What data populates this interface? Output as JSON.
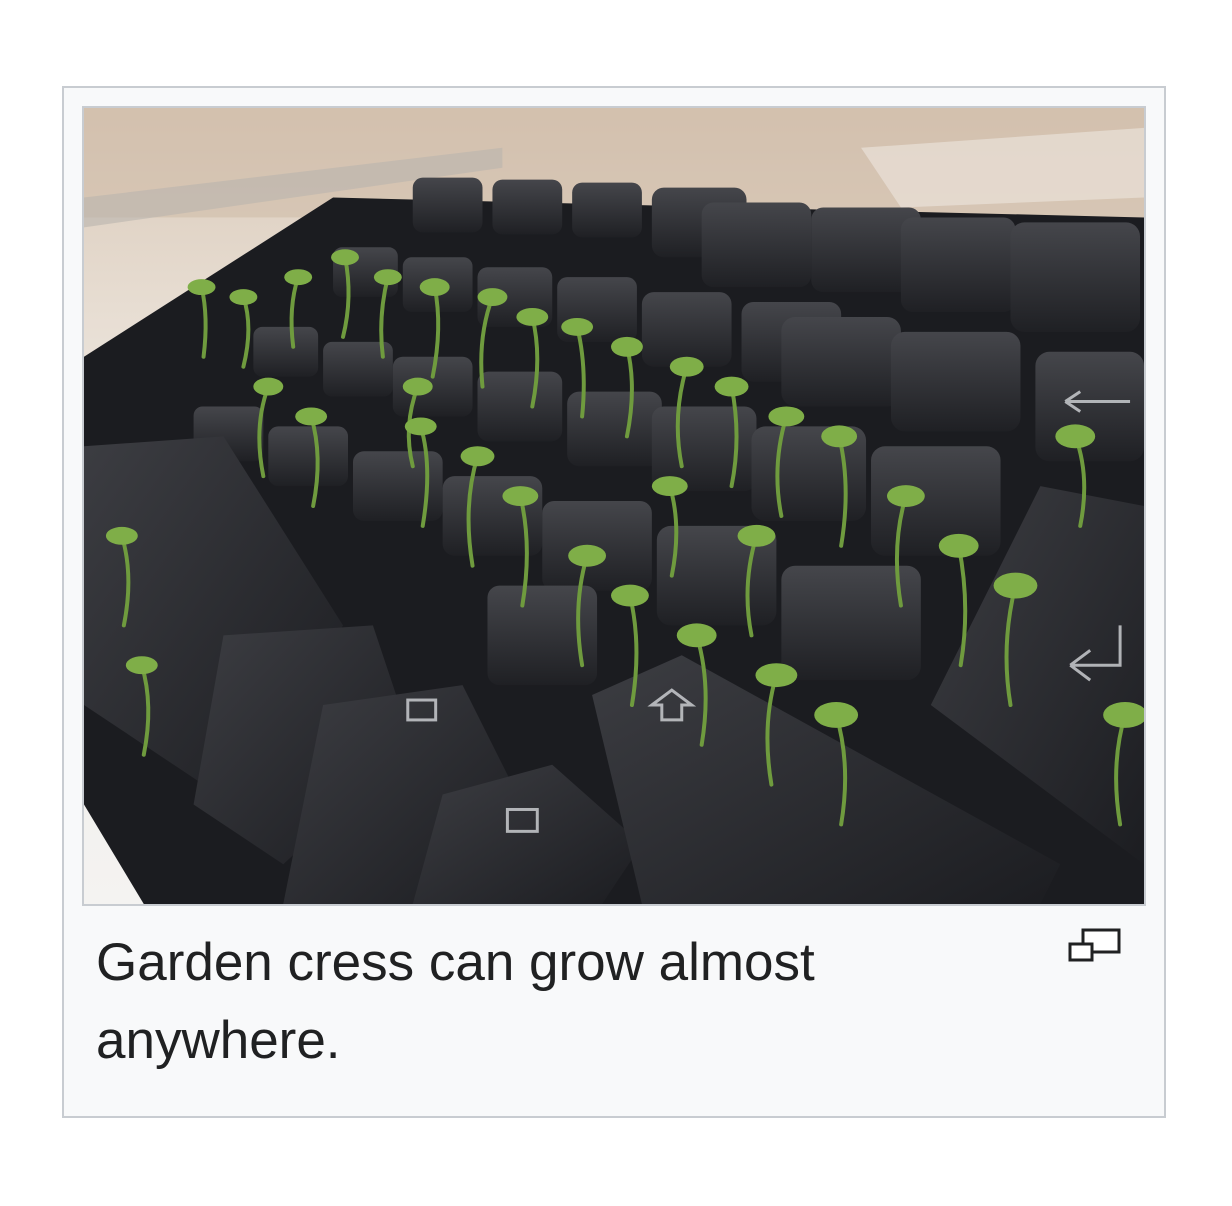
{
  "figure": {
    "caption": "Garden cress can grow almost anywhere.",
    "image_subject": "computer keyboard with garden cress seedlings growing between the keys",
    "magnify_icon": "enlarge-icon"
  },
  "colors": {
    "frame_background": "#f8f9fa",
    "frame_border": "#c8ccd1",
    "caption_text": "#202122",
    "keycap": "#2b2c30",
    "sprout": "#6f9b3e"
  }
}
